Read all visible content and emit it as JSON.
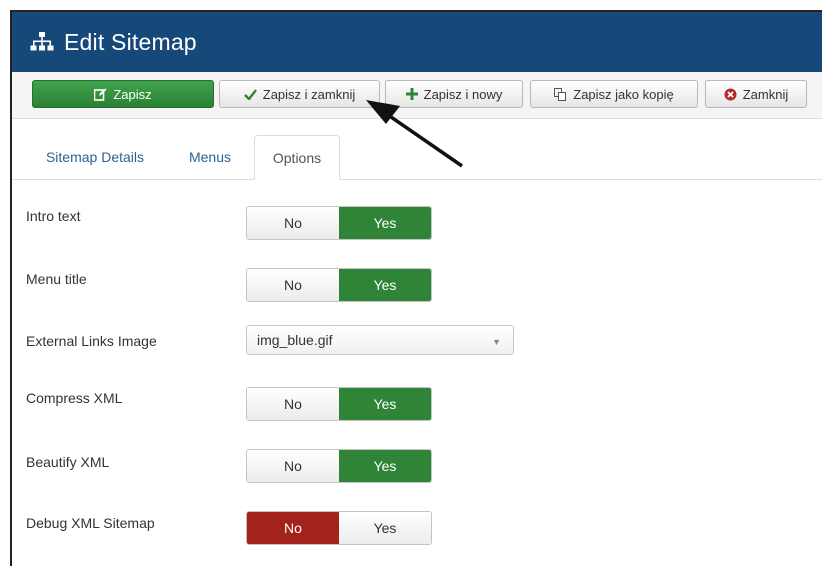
{
  "header": {
    "title": "Edit Sitemap",
    "icon": "sitemap-icon",
    "bg_color": "#17487a"
  },
  "toolbar": {
    "save": "Zapisz",
    "save_close": "Zapisz i zamknij",
    "save_new": "Zapisz i nowy",
    "save_copy": "Zapisz jako kopię",
    "close": "Zamknij"
  },
  "tabs": [
    {
      "label": "Sitemap Details",
      "active": false
    },
    {
      "label": "Menus",
      "active": false
    },
    {
      "label": "Options",
      "active": true
    }
  ],
  "options": {
    "intro_text": {
      "label": "Intro text",
      "no": "No",
      "yes": "Yes",
      "value": "Yes"
    },
    "menu_title": {
      "label": "Menu title",
      "no": "No",
      "yes": "Yes",
      "value": "Yes"
    },
    "external_links_image": {
      "label": "External Links Image",
      "value": "img_blue.gif"
    },
    "compress_xml": {
      "label": "Compress XML",
      "no": "No",
      "yes": "Yes",
      "value": "Yes"
    },
    "beautify_xml": {
      "label": "Beautify XML",
      "no": "No",
      "yes": "Yes",
      "value": "Yes"
    },
    "debug_xml_sitemap": {
      "label": "Debug XML Sitemap",
      "no": "No",
      "yes": "Yes",
      "value": "No"
    }
  },
  "colors": {
    "yes_active": "#2f8438",
    "no_active": "#a3221c",
    "link": "#2a6496"
  }
}
